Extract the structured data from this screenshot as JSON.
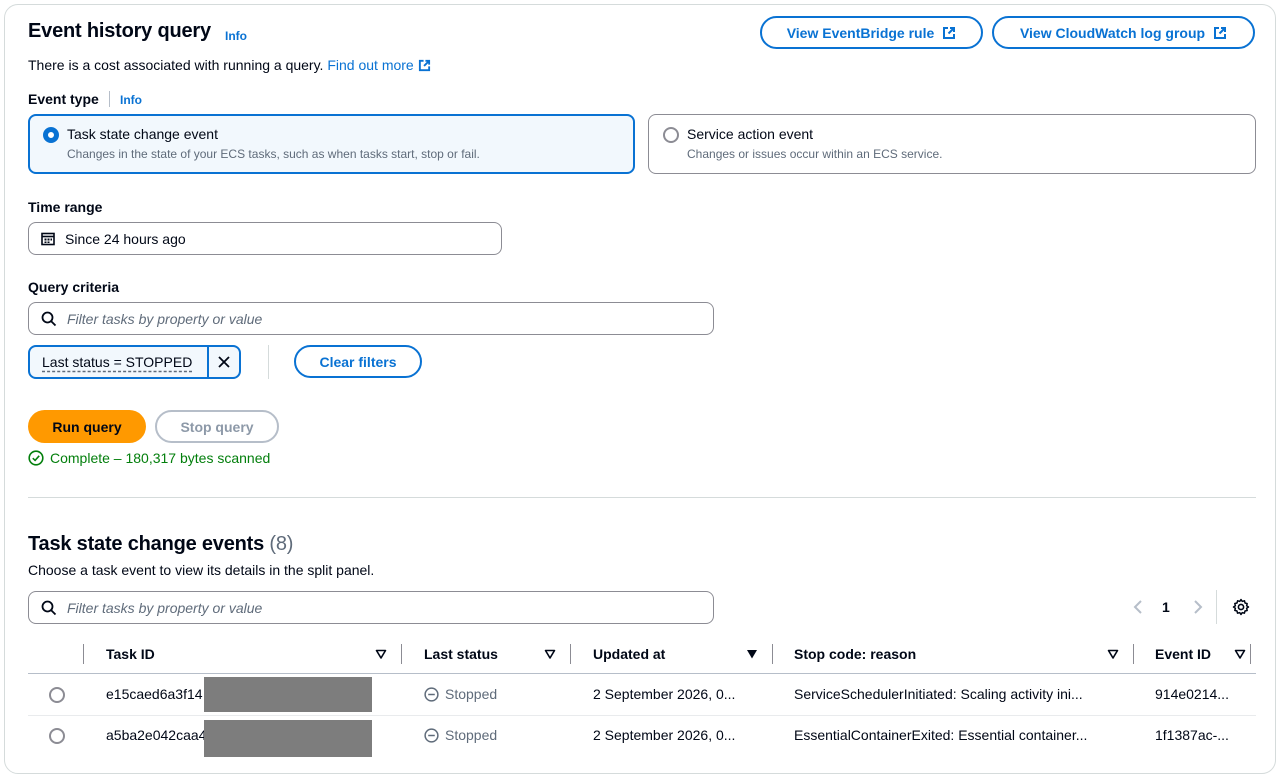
{
  "header": {
    "title": "Event history query",
    "info": "Info",
    "eventbridge_button": "View EventBridge rule",
    "cloudwatch_button": "View CloudWatch log group",
    "cost_text": "There is a cost associated with running a query.",
    "find_out_more": "Find out more"
  },
  "event_type": {
    "label": "Event type",
    "info": "Info",
    "options": [
      {
        "title": "Task state change event",
        "description": "Changes in the state of your ECS tasks, such as when tasks start, stop or fail.",
        "selected": true
      },
      {
        "title": "Service action event",
        "description": "Changes or issues occur within an ECS service.",
        "selected": false
      }
    ]
  },
  "time_range": {
    "label": "Time range",
    "value": "Since 24 hours ago"
  },
  "query_criteria": {
    "label": "Query criteria",
    "placeholder": "Filter tasks by property or value",
    "token": "Last status = STOPPED",
    "clear_filters": "Clear filters"
  },
  "actions": {
    "run_query": "Run query",
    "stop_query": "Stop query",
    "status": "Complete – 180,317 bytes scanned"
  },
  "events": {
    "title": "Task state change events",
    "count": "(8)",
    "description": "Choose a task event to view its details in the split panel.",
    "filter_placeholder": "Filter tasks by property or value",
    "page": "1",
    "columns": [
      "Task ID",
      "Last status",
      "Updated at",
      "Stop code: reason",
      "Event ID"
    ],
    "rows": [
      {
        "task_id": "e15caed6a3f14",
        "status": "Stopped",
        "updated": "2 September 2026, 0...",
        "stop_reason": "ServiceSchedulerInitiated: Scaling activity ini...",
        "event_id": "914e0214..."
      },
      {
        "task_id": "a5ba2e042caa4",
        "status": "Stopped",
        "updated": "2 September 2026, 0...",
        "stop_reason": "EssentialContainerExited: Essential container...",
        "event_id": "1f1387ac-..."
      }
    ]
  },
  "colors": {
    "accent": "#0972d3",
    "primary_button": "#ff9900",
    "success": "#037f0c",
    "border": "#8c8c94"
  }
}
